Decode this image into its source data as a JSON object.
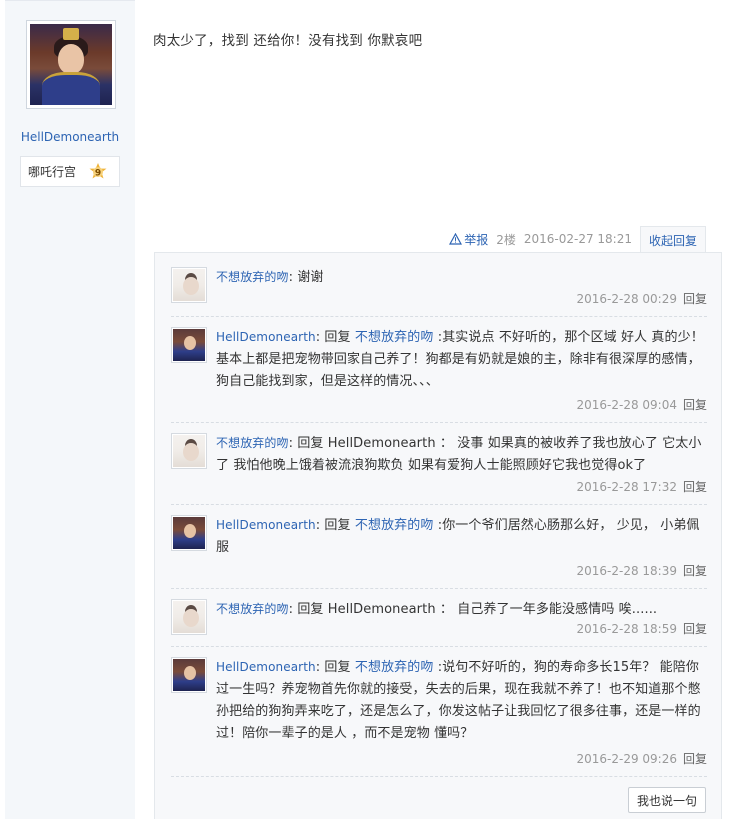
{
  "author": {
    "username": "HellDemonearth",
    "badge_name": "哪吒行宫",
    "badge_level": "9"
  },
  "post": {
    "content": "肉太少了，找到 还给你！没有找到 你默哀吧",
    "report_label": "举报",
    "floor": "2楼",
    "time": "2016-02-27 18:21",
    "collapse_label": "收起回复"
  },
  "replies": [
    {
      "user": "不想放弃的吻",
      "prefix": ":",
      "target": "",
      "text": " 谢谢",
      "time": "2016-2-28 00:29",
      "reply_label": "回复",
      "avatar": "girl"
    },
    {
      "user": "HellDemonearth",
      "prefix": ": 回复 ",
      "target": "不想放弃的吻",
      "text": " :其实说点 不好听的，那个区域 好人 真的少！基本上都是把宠物带回家自己养了！狗都是有奶就是娘的主，除非有很深厚的感情，狗自己能找到家，但是这样的情况、、、",
      "time": "2016-2-28 09:04",
      "reply_label": "回复",
      "avatar": "warrior"
    },
    {
      "user": "不想放弃的吻",
      "prefix": ": 回复 HellDemonearth ：",
      "target": "",
      "text": " 没事 如果真的被收养了我也放心了 它太小了 我怕他晚上饿着被流浪狗欺负 如果有爱狗人士能照顾好它我也觉得ok了",
      "time": "2016-2-28 17:32",
      "reply_label": "回复",
      "avatar": "girl"
    },
    {
      "user": "HellDemonearth",
      "prefix": ": 回复 ",
      "target": "不想放弃的吻",
      "text": " :你一个爷们居然心肠那么好， 少见， 小弟佩服",
      "time": "2016-2-28 18:39",
      "reply_label": "回复",
      "avatar": "warrior"
    },
    {
      "user": "不想放弃的吻",
      "prefix": ": 回复 HellDemonearth ：",
      "target": "",
      "text": " 自己养了一年多能没感情吗 唉......",
      "time": "2016-2-28 18:59",
      "reply_label": "回复",
      "avatar": "girl"
    },
    {
      "user": "HellDemonearth",
      "prefix": ": 回复 ",
      "target": "不想放弃的吻",
      "text": " :说句不好听的，狗的寿命多长15年？ 能陪你过一生吗？养宠物首先你就的接受，失去的后果，现在我就不养了！也不知道那个憋孙把给的狗狗弄来吃了，还是怎么了，你发这帖子让我回忆了很多往事，还是一样的过！陪你一辈子的是人 ，而不是宠物 懂吗？",
      "time": "2016-2-29 09:26",
      "reply_label": "回复",
      "avatar": "warrior"
    }
  ],
  "say_button": "我也说一句",
  "colors": {
    "link": "#2d64b3",
    "muted": "#999999",
    "panel": "#f7f8fa"
  }
}
